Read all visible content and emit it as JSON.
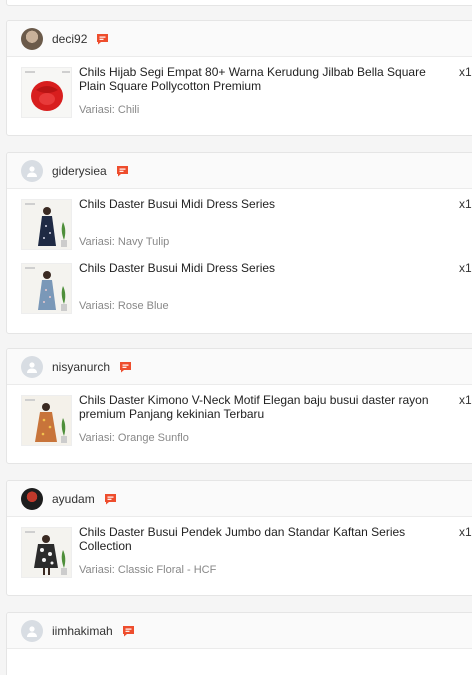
{
  "colors": {
    "chat_icon": "#ee4d2d",
    "background": "#f5f5f5",
    "muted_text": "#888888"
  },
  "orders": [
    {
      "username": "deci92",
      "avatar_icon": "user-photo-avatar",
      "items": [
        {
          "title": "Chils Hijab Segi Empat 80+ Warna Kerudung Jilbab Bella Square Plain Square Pollycotton Premium",
          "variant": "Variasi: Chili",
          "qty": "x1"
        }
      ]
    },
    {
      "username": "giderysiea",
      "avatar_icon": "default-avatar-icon",
      "items": [
        {
          "title": "Chils Daster Busui Midi Dress Series",
          "variant": "Variasi: Navy Tulip",
          "qty": "x1"
        },
        {
          "title": "Chils Daster Busui Midi Dress Series",
          "variant": "Variasi: Rose Blue",
          "qty": "x1"
        }
      ]
    },
    {
      "username": "nisyanurch",
      "avatar_icon": "default-avatar-icon",
      "items": [
        {
          "title": "Chils Daster Kimono V-Neck Motif Elegan baju busui daster rayon premium Panjang kekinian Terbaru",
          "variant": "Variasi: Orange Sunflo",
          "qty": "x1"
        }
      ]
    },
    {
      "username": "ayudam",
      "avatar_icon": "user-photo-avatar",
      "items": [
        {
          "title": "Chils Daster Busui Pendek Jumbo dan Standar Kaftan Series Collection",
          "variant": "Variasi: Classic Floral - HCF",
          "qty": "x1"
        }
      ]
    },
    {
      "username": "iimhakimah",
      "avatar_icon": "default-avatar-icon",
      "items": []
    }
  ]
}
